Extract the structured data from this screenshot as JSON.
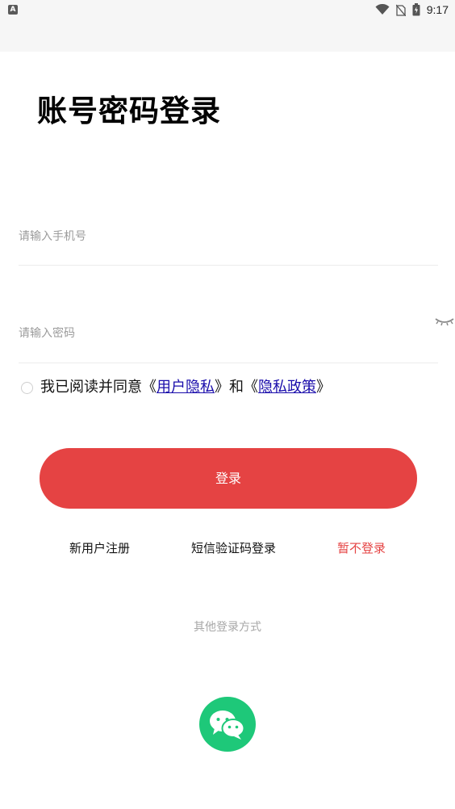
{
  "status_bar": {
    "left_icon": "A",
    "time": "9:17",
    "icons": [
      "wifi-icon",
      "no-sim-icon",
      "battery-icon"
    ]
  },
  "page": {
    "title": "账号密码登录"
  },
  "form": {
    "phone_placeholder": "请输入手机号",
    "password_placeholder": "请输入密码"
  },
  "agreement": {
    "prefix": "我已阅读并同意《",
    "terms_link": "用户隐私",
    "middle": "》和《",
    "privacy_link": "隐私政策",
    "suffix": "》"
  },
  "actions": {
    "login_label": "登录",
    "register_label": "新用户注册",
    "sms_login_label": "短信验证码登录",
    "skip_login_label": "暂不登录"
  },
  "other_login": {
    "label": "其他登录方式",
    "methods": [
      "wechat-icon"
    ]
  },
  "colors": {
    "primary": "#e54343",
    "wechat": "#1ec879",
    "link": "#1a0dab",
    "placeholder": "#9b9b9b"
  }
}
